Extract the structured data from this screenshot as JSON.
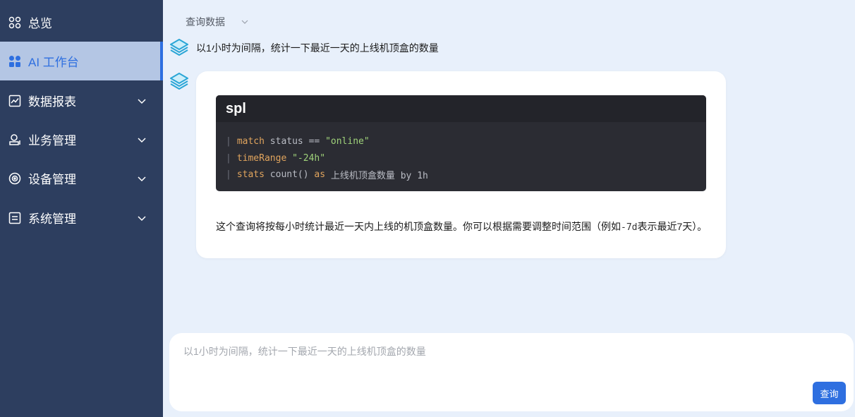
{
  "sidebar": {
    "items": [
      {
        "label": "总览",
        "icon": "grid-icon",
        "has_chevron": false,
        "active": false
      },
      {
        "label": "AI 工作台",
        "icon": "apps-icon",
        "has_chevron": false,
        "active": true
      },
      {
        "label": "数据报表",
        "icon": "chart-icon",
        "has_chevron": true,
        "active": false
      },
      {
        "label": "业务管理",
        "icon": "business-icon",
        "has_chevron": true,
        "active": false
      },
      {
        "label": "设备管理",
        "icon": "device-icon",
        "has_chevron": true,
        "active": false
      },
      {
        "label": "系统管理",
        "icon": "system-icon",
        "has_chevron": true,
        "active": false
      }
    ]
  },
  "header": {
    "select_label": "查询数据"
  },
  "chat": {
    "user_message": "以1小时为间隔，统计一下最近一天的上线机顶盒的数量",
    "reply": {
      "code_lang": "spl",
      "code_lines": [
        {
          "k1": "match",
          "p1": " status == ",
          "s1": "\"online\"",
          "p2": ""
        },
        {
          "k1": "timeRange",
          "p1": " ",
          "s1": "\"-24h\"",
          "p2": ""
        },
        {
          "k1": "stats",
          "p1": " count() ",
          "k2": "as",
          "p2": " 上线机顶盒数量 by 1h"
        }
      ],
      "explanation_before": "这个查询将按每小时统计最近一天内上线的机顶盒数量。你可以根据需要调整时间范围（例如",
      "explanation_code": "-7d",
      "explanation_after": "表示最近7天）。"
    }
  },
  "input": {
    "placeholder": "以1小时为间隔，统计一下最近一天的上线机顶盒的数量",
    "button_label": "查询"
  },
  "colors": {
    "sidebar_bg": "#2d3e5f",
    "active_item_bg": "#b4c6e4",
    "accent": "#2e6fe0",
    "page_bg": "#e8f0fb"
  }
}
